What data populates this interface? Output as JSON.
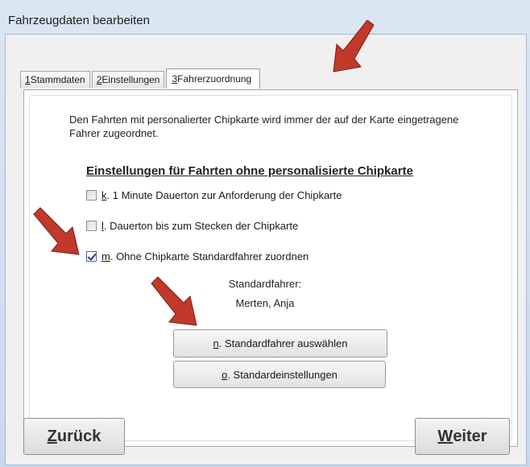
{
  "window": {
    "title": "Fahrzeugdaten bearbeiten"
  },
  "tabs": [
    {
      "key": "1",
      "label": " Stammdaten"
    },
    {
      "key": "2",
      "label": " Einstellungen"
    },
    {
      "key": "3",
      "label": " Fahrerzuordnung"
    }
  ],
  "panel": {
    "description": "Den Fahrten mit personalierter Chipkarte wird immer der auf der Karte eingetragene Fahrer zugeordnet.",
    "section_title": "Einstellungen für Fahrten ohne personalisierte Chipkarte",
    "options": [
      {
        "key": "k",
        "label": ". 1 Minute Dauerton zur Anforderung der Chipkarte",
        "checked": false
      },
      {
        "key": "l",
        "label": ". Dauerton bis zum Stecken der Chipkarte",
        "checked": false
      },
      {
        "key": "m",
        "label": ". Ohne Chipkarte Standardfahrer zuordnen",
        "checked": true
      }
    ],
    "default_driver_label": "Standardfahrer:",
    "default_driver_value": "Merten, Anja",
    "select_button": {
      "key": "n",
      "label": ". Standardfahrer auswählen"
    },
    "defaults_button": {
      "key": "o",
      "label": ". Standardeinstellungen"
    }
  },
  "footer": {
    "back": {
      "key": "Z",
      "label": "urück"
    },
    "next": {
      "key": "W",
      "label": "eiter"
    }
  },
  "colors": {
    "arrow": "#c0392b"
  }
}
